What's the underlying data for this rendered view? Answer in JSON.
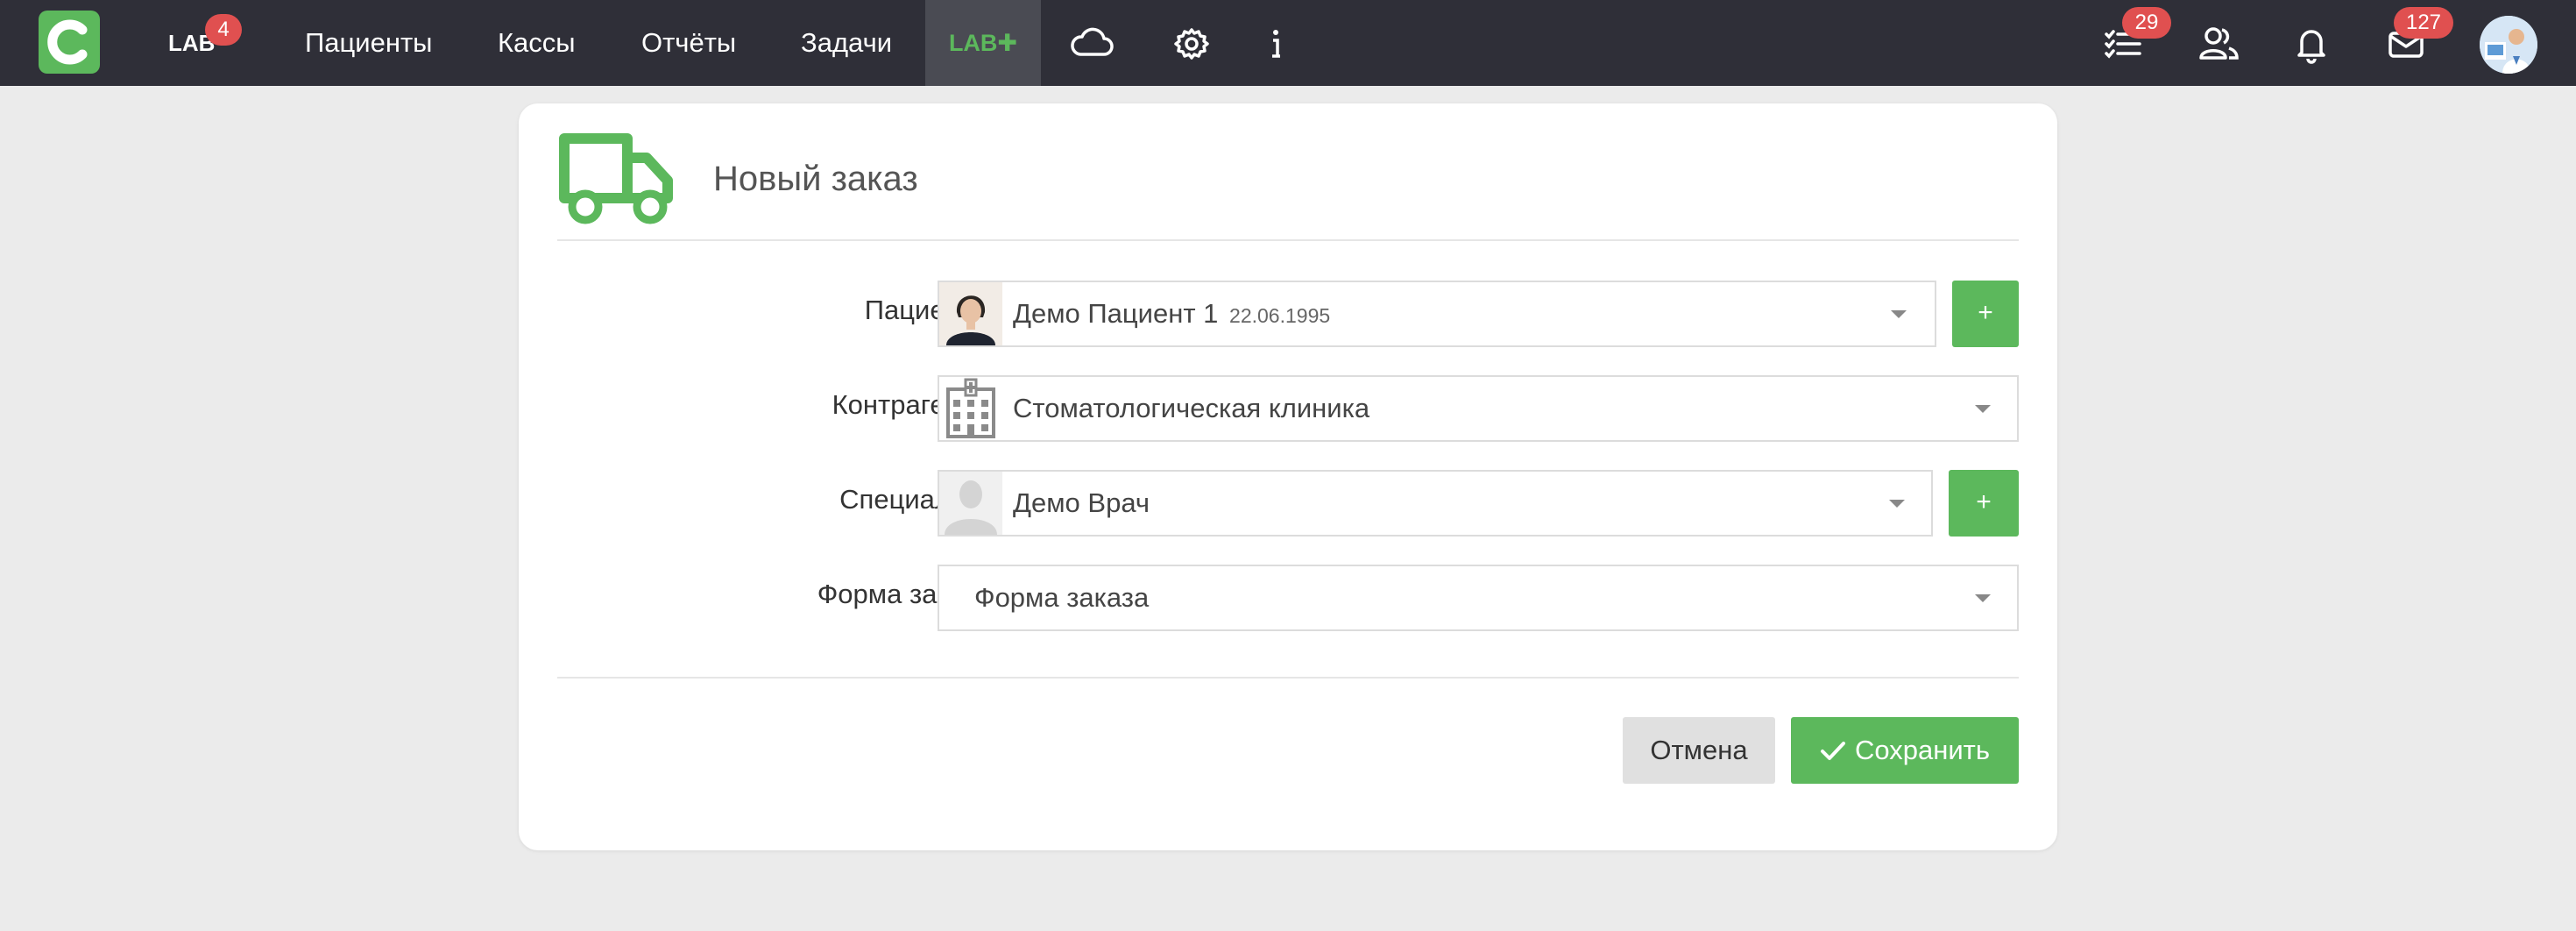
{
  "nav": {
    "lab_label": "LAB",
    "lab_badge": "4",
    "items": [
      "Пациенты",
      "Кассы",
      "Отчёты",
      "Задачи"
    ],
    "lab_plus_label": "LAB✚",
    "tasks_badge": "29",
    "messages_badge": "127"
  },
  "icons": [
    "logo-icon",
    "cloud-icon",
    "gear-icon",
    "info-icon",
    "tasks-list-icon",
    "users-icon",
    "bell-icon",
    "mail-icon",
    "avatar",
    "truck-icon",
    "building-icon",
    "chevron-down-icon",
    "check-icon"
  ],
  "form": {
    "title": "Новый заказ",
    "patient": {
      "label": "Пациент",
      "required": "*",
      "value": "Демо Пациент 1",
      "dob": "22.06.1995",
      "add": "+"
    },
    "contractor": {
      "label": "Контрагент",
      "required": "*",
      "value": "Стоматологическая клиника"
    },
    "specialist": {
      "label": "Специалист",
      "value": "Демо Врач",
      "add": "+"
    },
    "order_form": {
      "label": "Форма заказа",
      "value": "Форма заказа"
    }
  },
  "actions": {
    "cancel": "Отмена",
    "save": "Сохранить"
  },
  "colors": {
    "navbar": "#2f2f38",
    "accent": "#5cb85c",
    "badge": "#e05050",
    "background": "#ebebeb"
  }
}
